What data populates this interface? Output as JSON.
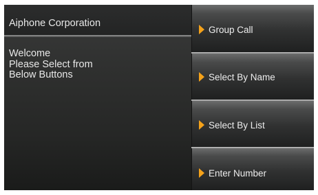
{
  "header": {
    "company_name": "Aiphone Corporation"
  },
  "welcome": {
    "lines": [
      "Welcome",
      "Please Select from",
      "Below Buttons"
    ]
  },
  "menu": {
    "items": [
      {
        "label": "Group Call",
        "icon": "play-arrow-icon"
      },
      {
        "label": "Select By Name",
        "icon": "play-arrow-icon"
      },
      {
        "label": "Select By List",
        "icon": "play-arrow-icon"
      },
      {
        "label": "Enter Number",
        "icon": "play-arrow-icon"
      }
    ]
  },
  "colors": {
    "accent": "#f5a21a",
    "background": "#000000",
    "text": "#e8e8e8"
  }
}
